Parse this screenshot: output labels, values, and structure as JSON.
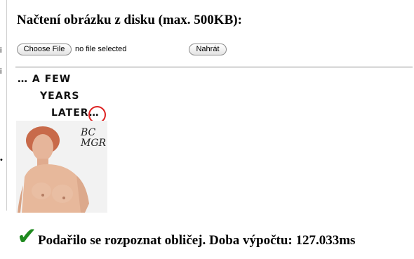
{
  "left_strip": {
    "marks": [
      "i",
      "i",
      "•"
    ]
  },
  "upload_form": {
    "heading": "Načtení obrázku z disku (max. 500KB):",
    "choose_file_label": "Choose File",
    "file_status": "no file selected",
    "submit_label": "Nahrát"
  },
  "image": {
    "caption_line1": "… A FEW",
    "caption_line2": "YEARS",
    "caption_line3": "LATER…",
    "watermark_line1": "BC",
    "watermark_line2": "MGR"
  },
  "result": {
    "icon": "checkmark-icon",
    "icon_glyph": "✔",
    "icon_color": "#1f8a1f",
    "message": "Podařilo se rozpoznat obličej. Doba výpočtu: 127.033ms"
  }
}
